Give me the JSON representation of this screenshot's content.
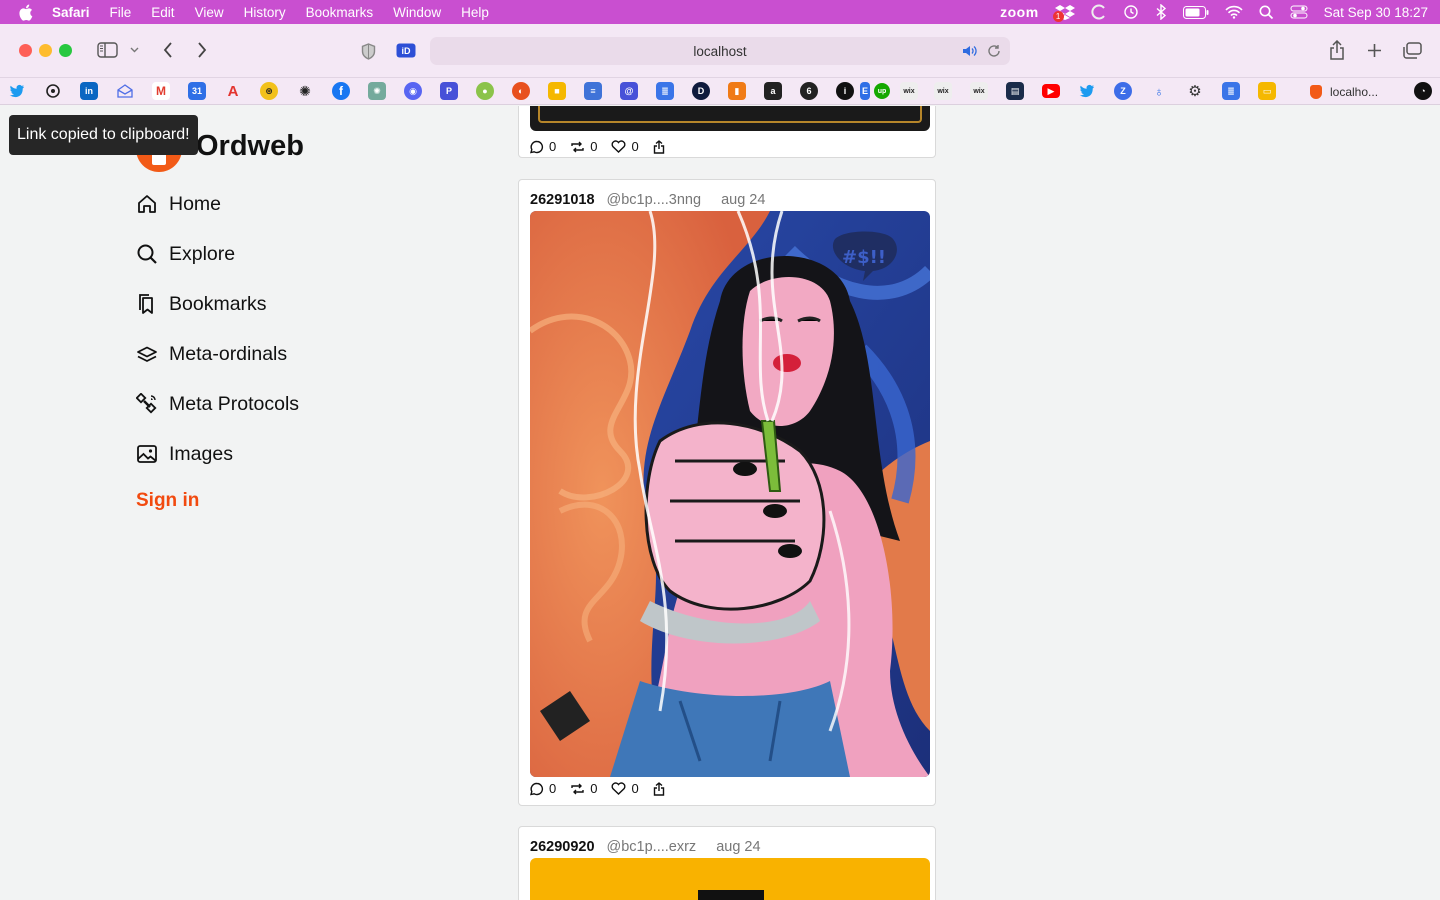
{
  "menubar": {
    "items": [
      "Safari",
      "File",
      "Edit",
      "View",
      "History",
      "Bookmarks",
      "Window",
      "Help"
    ],
    "zoom_label": "zoom",
    "clock": "Sat Sep 30  18:27",
    "dropbox_badge": "1"
  },
  "toolbar": {
    "url": "localhost"
  },
  "bookmarks": {
    "tab_label": "localho..."
  },
  "toast": {
    "text": "Link copied to clipboard!"
  },
  "brand": {
    "name": "Ordweb"
  },
  "nav": {
    "items": [
      {
        "label": "Home",
        "icon": "home-icon"
      },
      {
        "label": "Explore",
        "icon": "search-icon"
      },
      {
        "label": "Bookmarks",
        "icon": "bookmarks-icon"
      },
      {
        "label": "Meta-ordinals",
        "icon": "layers-icon"
      },
      {
        "label": "Meta Protocols",
        "icon": "satellite-icon"
      },
      {
        "label": "Images",
        "icon": "image-icon"
      }
    ],
    "signin": "Sign in"
  },
  "posts": [
    {
      "replies": "0",
      "reposts": "0",
      "likes": "0"
    },
    {
      "number": "26291018",
      "user": "@bc1p....3nng",
      "date": "aug 24",
      "replies": "0",
      "reposts": "0",
      "likes": "0"
    },
    {
      "number": "26290920",
      "user": "@bc1p....exrz",
      "date": "aug 24"
    }
  ],
  "art": {
    "speech_text": "#$!!"
  },
  "colors": {
    "accent": "#f24a0f",
    "menubar": "#c94fd0"
  }
}
